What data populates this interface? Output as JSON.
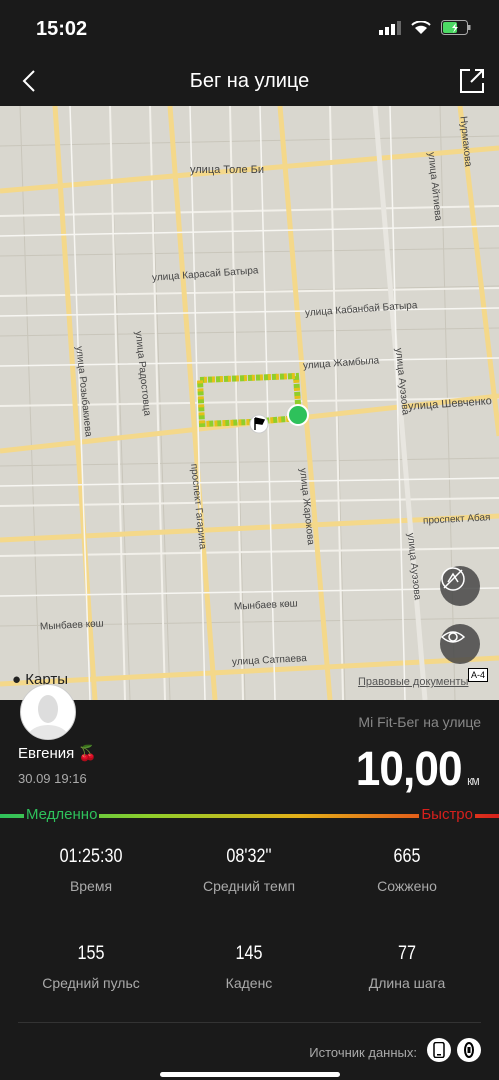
{
  "status_bar": {
    "time": "15:02"
  },
  "header": {
    "title": "Бег на улице"
  },
  "map": {
    "streets": [
      "улица Толе Би",
      "улица Карасай Батыра",
      "улица Кабанбай Батыра",
      "улица Жамбыла",
      "улица Шевченко",
      "улица Розыбакиева",
      "улица Радостовца",
      "проспект Гагарина",
      "улица Жарокова",
      "улица Ауэзова",
      "проспект Абая",
      "Мынбаев көш",
      "Мынбаев көш",
      "улица Сатпаева",
      "Нурмакова",
      "улица Айтиева",
      "улица Ауэзова"
    ],
    "logo": "Карты",
    "legal": "Правовые документы",
    "badge": "A-4"
  },
  "workout": {
    "user_name": "Евгения 🍒",
    "date": "30.09 19:16",
    "source": "Mi Fit-Бег на улице",
    "distance": "10,00",
    "distance_unit": "км",
    "pace_slow": "Медленно",
    "pace_fast": "Быстро"
  },
  "stats": [
    {
      "value": "01:25:30",
      "label": "Время"
    },
    {
      "value": "08'32''",
      "label": "Средний темп"
    },
    {
      "value": "665",
      "label": "Сожжено"
    },
    {
      "value": "155",
      "label": "Средний пульс"
    },
    {
      "value": "145",
      "label": "Каденс"
    },
    {
      "value": "77",
      "label": "Длина шага"
    }
  ],
  "footer": {
    "data_source_label": "Источник данных:"
  },
  "colors": {
    "accent_green": "#2ec15b",
    "accent_red": "#d6201c",
    "route_green": "#8fce2b",
    "route_yellow": "#e4c11a"
  }
}
